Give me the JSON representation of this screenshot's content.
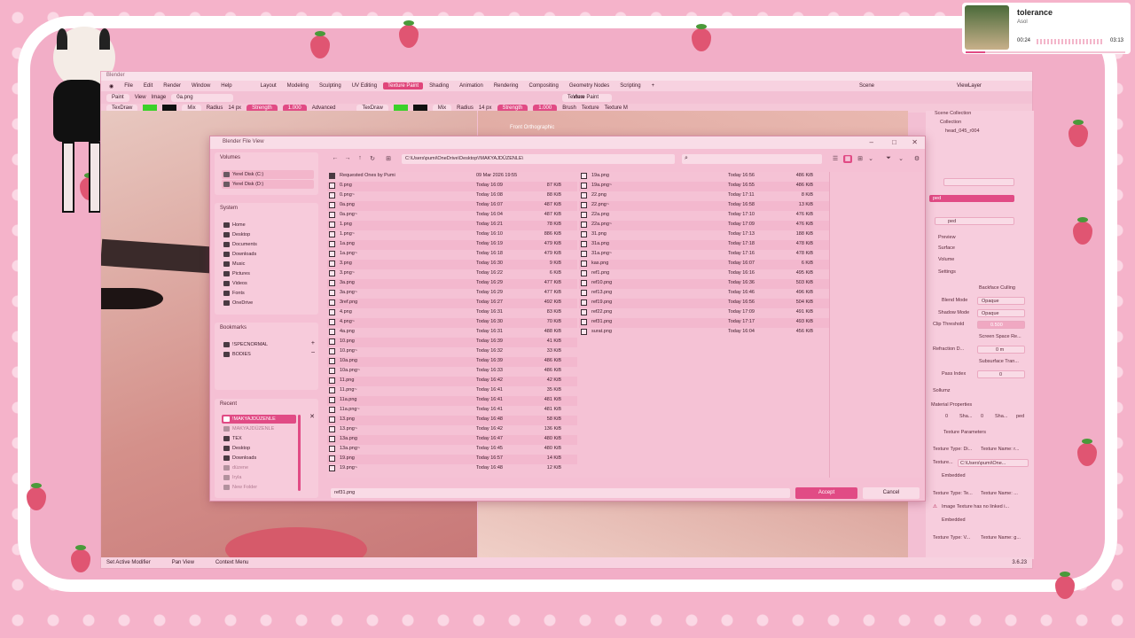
{
  "music": {
    "title": "tolerance",
    "artist": "Asol",
    "elapsed": "00:24",
    "total": "03:13"
  },
  "blender": {
    "title": "Blender",
    "menu": [
      "File",
      "Edit",
      "Render",
      "Window",
      "Help"
    ],
    "workspaces": [
      "Layout",
      "Modeling",
      "Sculpting",
      "UV Editing",
      "Texture Paint",
      "Shading",
      "Animation",
      "Rendering",
      "Compositing",
      "Geometry Nodes",
      "Scripting"
    ],
    "active_workspace": "Texture Paint",
    "scene": "Scene",
    "viewlayer": "ViewLayer",
    "left_header": {
      "mode": "Paint",
      "view": "View",
      "image": "Image",
      "file": "0a.png",
      "brush": "TexDraw",
      "blend": "Mix",
      "radius_label": "Radius",
      "radius": "14 px",
      "strength_label": "Strength",
      "strength": "1.000",
      "advanced": "Advanced"
    },
    "right_header": {
      "mode": "Texture Paint",
      "view": "View",
      "brush": "TexDraw",
      "blend": "Mix",
      "radius_label": "Radius",
      "radius": "14 px",
      "strength_label": "Strength",
      "strength": "1.000",
      "brush_menu": "Brush",
      "texture_menu": "Texture",
      "texture_mask": "Texture M"
    },
    "viewport_label": "Front Orthographic",
    "outliner": {
      "collection_root": "Scene Collection",
      "collection": "Collection",
      "object": "head_045_r004"
    },
    "props": {
      "search": "ped",
      "preview": "Preview",
      "surface": "Surface",
      "volume": "Volume",
      "settings": "Settings",
      "backface": "Backface Culling",
      "blend_mode": "Blend Mode",
      "blend_val": "Opaque",
      "shadow_mode": "Shadow Mode",
      "shadow_val": "Opaque",
      "clip": "Clip Threshold",
      "clip_val": "0.500",
      "screen_space": "Screen Space Re...",
      "refraction": "Refraction D...",
      "refraction_val": "0 m",
      "subsurface": "Subsurface Tran...",
      "pass_index": "Pass Index",
      "pass_val": "0",
      "sollumz": "Sollumz",
      "material_props": "Material Properties",
      "mp_vals": [
        "0",
        "Sha...",
        "0",
        "Sha...",
        "ped"
      ],
      "tex_params": "Texture Parameters",
      "tex_type1": "Texture Type: Di...",
      "tex_name1": "Texture Name: r...",
      "texture_label": "Texture...",
      "texture_path": "C:\\Users\\pumi\\One...",
      "embedded": "Embedded",
      "tex_type2": "Texture Type: Te...",
      "tex_name2": "Texture Name: ...",
      "warning": "Image Texture has no linked i...",
      "embedded2": "Embedded",
      "tex_type3": "Texture Type: V...",
      "tex_name3": "Texture Name: g..."
    },
    "status": [
      "Set Active Modifier",
      "Pan View",
      "Context Menu"
    ],
    "version": "3.6.23"
  },
  "dialog": {
    "title": "Blender File View",
    "volumes_header": "Volumes",
    "volumes": [
      "Yerel Disk (C:)",
      "Yerel Disk (D:)"
    ],
    "system_header": "System",
    "system": [
      "Home",
      "Desktop",
      "Documents",
      "Downloads",
      "Music",
      "Pictures",
      "Videos",
      "Fonts",
      "OneDrive"
    ],
    "bookmarks_header": "Bookmarks",
    "bookmarks": [
      "!SPECNORMAL",
      "BODIES"
    ],
    "recent_header": "Recent",
    "recent": [
      "!MAKYAJDÜZENLE",
      "MAKYAJDÜZENLE",
      "TEX",
      "Desktop",
      "Downloads",
      "düzene",
      "Iryla",
      "New Folder",
      "YORS"
    ],
    "path": "C:\\Users\\pumi\\OneDrive\\Desktop\\!MAKYAJDÜZENLE\\",
    "filename": "ref31.png",
    "accept": "Accept",
    "cancel": "Cancel",
    "files_col1": [
      {
        "name": "Requested Ones by Pumi",
        "date": "09 Mar 2026 19:55",
        "size": "",
        "folder": true
      },
      {
        "name": "0.png",
        "date": "Today 16:09",
        "size": "87 KiB"
      },
      {
        "name": "0.png~",
        "date": "Today 16:08",
        "size": "88 KiB"
      },
      {
        "name": "0a.png",
        "date": "Today 16:07",
        "size": "487 KiB"
      },
      {
        "name": "0a.png~",
        "date": "Today 16:04",
        "size": "487 KiB"
      },
      {
        "name": "1.png",
        "date": "Today 16:21",
        "size": "78 KiB"
      },
      {
        "name": "1.png~",
        "date": "Today 16:10",
        "size": "886 KiB"
      },
      {
        "name": "1a.png",
        "date": "Today 16:19",
        "size": "479 KiB"
      },
      {
        "name": "1a.png~",
        "date": "Today 16:18",
        "size": "479 KiB"
      },
      {
        "name": "3.png",
        "date": "Today 16:30",
        "size": "9 KiB"
      },
      {
        "name": "3.png~",
        "date": "Today 16:22",
        "size": "6 KiB"
      },
      {
        "name": "3a.png",
        "date": "Today 16:29",
        "size": "477 KiB"
      },
      {
        "name": "3a.png~",
        "date": "Today 16:29",
        "size": "477 KiB"
      },
      {
        "name": "3ref.png",
        "date": "Today 16:27",
        "size": "492 KiB"
      },
      {
        "name": "4.png",
        "date": "Today 16:31",
        "size": "83 KiB"
      },
      {
        "name": "4.png~",
        "date": "Today 16:30",
        "size": "70 KiB"
      },
      {
        "name": "4a.png",
        "date": "Today 16:31",
        "size": "488 KiB"
      },
      {
        "name": "10.png",
        "date": "Today 16:39",
        "size": "41 KiB"
      },
      {
        "name": "10.png~",
        "date": "Today 16:32",
        "size": "33 KiB"
      },
      {
        "name": "10a.png",
        "date": "Today 16:39",
        "size": "486 KiB"
      },
      {
        "name": "10a.png~",
        "date": "Today 16:33",
        "size": "486 KiB"
      },
      {
        "name": "11.png",
        "date": "Today 16:42",
        "size": "42 KiB"
      },
      {
        "name": "11.png~",
        "date": "Today 16:41",
        "size": "35 KiB"
      },
      {
        "name": "11a.png",
        "date": "Today 16:41",
        "size": "481 KiB"
      },
      {
        "name": "11a.png~",
        "date": "Today 16:41",
        "size": "481 KiB"
      },
      {
        "name": "13.png",
        "date": "Today 16:48",
        "size": "58 KiB"
      },
      {
        "name": "13.png~",
        "date": "Today 16:42",
        "size": "136 KiB"
      },
      {
        "name": "13a.png",
        "date": "Today 16:47",
        "size": "480 KiB"
      },
      {
        "name": "13a.png~",
        "date": "Today 16:45",
        "size": "480 KiB"
      },
      {
        "name": "19.png",
        "date": "Today 16:57",
        "size": "14 KiB"
      },
      {
        "name": "19.png~",
        "date": "Today 16:48",
        "size": "12 KiB"
      }
    ],
    "files_col2": [
      {
        "name": "19a.png",
        "date": "Today 16:56",
        "size": "486 KiB"
      },
      {
        "name": "19a.png~",
        "date": "Today 16:55",
        "size": "486 KiB"
      },
      {
        "name": "22.png",
        "date": "Today 17:11",
        "size": "8 KiB"
      },
      {
        "name": "22.png~",
        "date": "Today 16:58",
        "size": "13 KiB"
      },
      {
        "name": "22a.png",
        "date": "Today 17:10",
        "size": "476 KiB"
      },
      {
        "name": "22a.png~",
        "date": "Today 17:09",
        "size": "476 KiB"
      },
      {
        "name": "31.png",
        "date": "Today 17:13",
        "size": "188 KiB"
      },
      {
        "name": "31a.png",
        "date": "Today 17:18",
        "size": "478 KiB"
      },
      {
        "name": "31a.png~",
        "date": "Today 17:16",
        "size": "478 KiB"
      },
      {
        "name": "kas.png",
        "date": "Today 16:07",
        "size": "6 KiB"
      },
      {
        "name": "ref1.png",
        "date": "Today 16:16",
        "size": "495 KiB"
      },
      {
        "name": "ref10.png",
        "date": "Today 16:36",
        "size": "503 KiB"
      },
      {
        "name": "ref13.png",
        "date": "Today 16:46",
        "size": "496 KiB"
      },
      {
        "name": "ref19.png",
        "date": "Today 16:56",
        "size": "504 KiB"
      },
      {
        "name": "ref22.png",
        "date": "Today 17:09",
        "size": "491 KiB"
      },
      {
        "name": "ref31.png",
        "date": "Today 17:17",
        "size": "493 KiB"
      },
      {
        "name": "surat.png",
        "date": "Today 16:04",
        "size": "456 KiB"
      }
    ]
  },
  "colors": {
    "accent": "#e14b85",
    "panel": "#f5c0d4",
    "field": "#f9dbe6"
  }
}
